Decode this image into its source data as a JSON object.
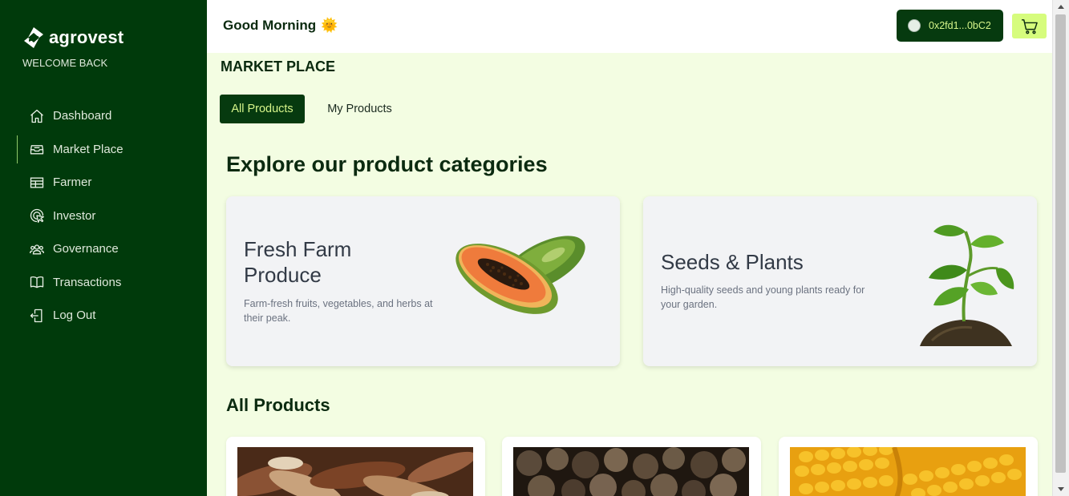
{
  "brand": {
    "name": "agrovest",
    "welcome": "WELCOME BACK"
  },
  "sidebar": {
    "items": [
      {
        "label": "Dashboard",
        "icon": "home-icon"
      },
      {
        "label": "Market Place",
        "icon": "inbox-icon",
        "active": true
      },
      {
        "label": "Farmer",
        "icon": "table-icon"
      },
      {
        "label": "Investor",
        "icon": "pointer-icon"
      },
      {
        "label": "Governance",
        "icon": "users-icon"
      },
      {
        "label": "Transactions",
        "icon": "book-icon"
      },
      {
        "label": "Log Out",
        "icon": "logout-icon"
      }
    ]
  },
  "header": {
    "greeting": "Good Morning",
    "greeting_emoji": "🌞",
    "wallet_address": "0x2fd1...0bC2",
    "cart_icon": "cart-icon"
  },
  "main": {
    "page_title": "MARKET PLACE",
    "tabs": [
      {
        "label": "All Products",
        "active": true
      },
      {
        "label": "My Products",
        "active": false
      }
    ],
    "categories_title": "Explore our product categories",
    "categories": [
      {
        "title": "Fresh Farm Produce",
        "description": "Farm-fresh fruits, vegetables, and herbs at their peak.",
        "image": "papaya"
      },
      {
        "title": "Seeds & Plants",
        "description": "High-quality seeds and young plants ready for your garden.",
        "image": "seedling"
      }
    ],
    "all_products_title": "All Products",
    "products": [
      {
        "image": "cassava"
      },
      {
        "image": "yams"
      },
      {
        "image": "corn"
      }
    ]
  },
  "colors": {
    "sidebar_bg": "#003a0b",
    "accent": "#d6fc7d",
    "page_bg": "#f3fde2"
  }
}
